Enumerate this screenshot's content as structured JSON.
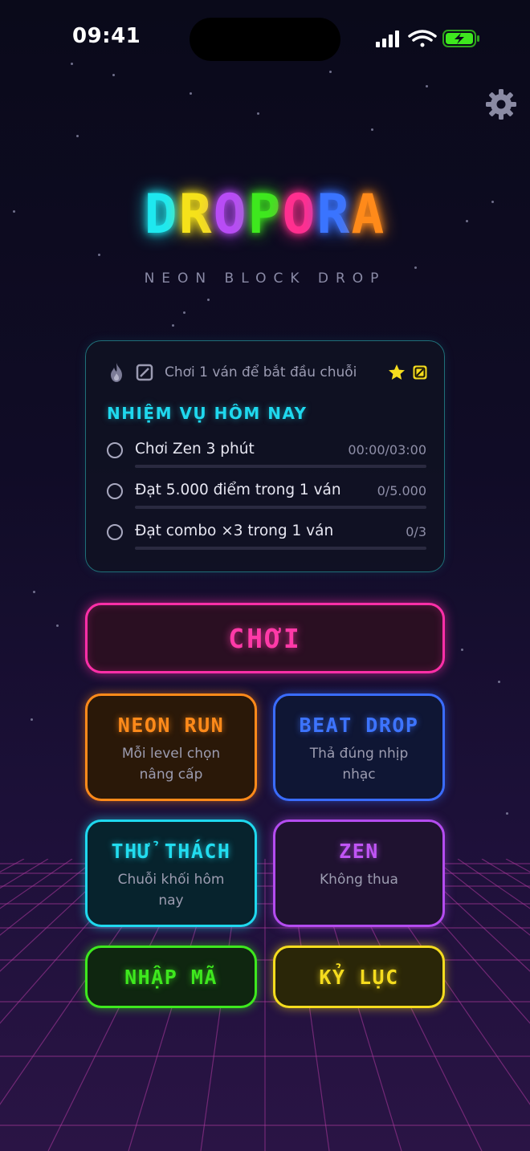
{
  "status_bar": {
    "time": "09:41"
  },
  "header": {
    "logo_letters": [
      {
        "char": "D",
        "color": "#1ee8f0"
      },
      {
        "char": "R",
        "color": "#f5e21a"
      },
      {
        "char": "O",
        "color": "#b84cf5"
      },
      {
        "char": "P",
        "color": "#3ee81e"
      },
      {
        "char": "O",
        "color": "#ff2f8f"
      },
      {
        "char": "R",
        "color": "#3a74ff"
      },
      {
        "char": "A",
        "color": "#ff8a1a"
      }
    ],
    "subtitle": "NEON BLOCK DROP"
  },
  "daily_card": {
    "streak_text": "Chơi 1 ván để bắt đầu chuỗi",
    "missions_title": "NHIỆM VỤ HÔM NAY",
    "missions": [
      {
        "label": "Chơi Zen 3 phút",
        "progress": "00:00/03:00",
        "completed": false,
        "fraction": 0
      },
      {
        "label": "Đạt 5.000 điểm trong 1 ván",
        "progress": "0/5.000",
        "completed": false,
        "fraction": 0
      },
      {
        "label": "Đạt combo ×3 trong 1 ván",
        "progress": "0/3",
        "completed": false,
        "fraction": 0
      }
    ]
  },
  "buttons": {
    "play": "CHƠI",
    "neon_run": {
      "title": "NEON RUN",
      "desc": "Mỗi level chọn nâng cấp"
    },
    "beat_drop": {
      "title": "BEAT DROP",
      "desc": "Thả đúng nhịp nhạc"
    },
    "challenge": {
      "title": "THỬ THÁCH",
      "desc": "Chuỗi khối hôm nay"
    },
    "zen": {
      "title": "ZEN",
      "desc": "Không thua"
    },
    "enter_code": {
      "title": "NHẬP MÃ"
    },
    "records": {
      "title": "KỶ LỤC"
    }
  },
  "icons": {
    "settings": "gear-icon",
    "streak": "flame-icon",
    "freeze": "square-slash-icon",
    "star": "star-icon",
    "bonus": "square-slash-icon"
  },
  "colors": {
    "accent_cyan": "#1fd8ee",
    "play_pink": "#ff2fa8",
    "neon_orange": "#ff8a1a",
    "beat_blue": "#3a6cff",
    "zen_purple": "#b44cf0",
    "code_green": "#3ee81e",
    "record_yellow": "#f5dc1e"
  }
}
